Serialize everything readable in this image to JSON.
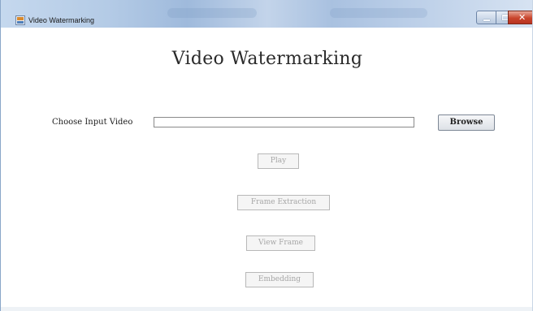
{
  "window": {
    "title": "Video Watermarking",
    "controls": {
      "minimize_icon": "minimize-icon",
      "maximize_icon": "maximize-icon",
      "close_glyph": "✕"
    }
  },
  "main": {
    "heading": "Video Watermarking",
    "input": {
      "label": "Choose Input Video",
      "value": "",
      "placeholder": ""
    },
    "buttons": {
      "browse": "Browse",
      "play": "Play",
      "frame_extraction": "Frame Extraction",
      "view_frame": "View Frame",
      "embedding": "Embedding"
    }
  },
  "colors": {
    "titlebar": "#b4cbe6",
    "close_button": "#c8452d",
    "disabled_text": "#a6a6a6"
  }
}
